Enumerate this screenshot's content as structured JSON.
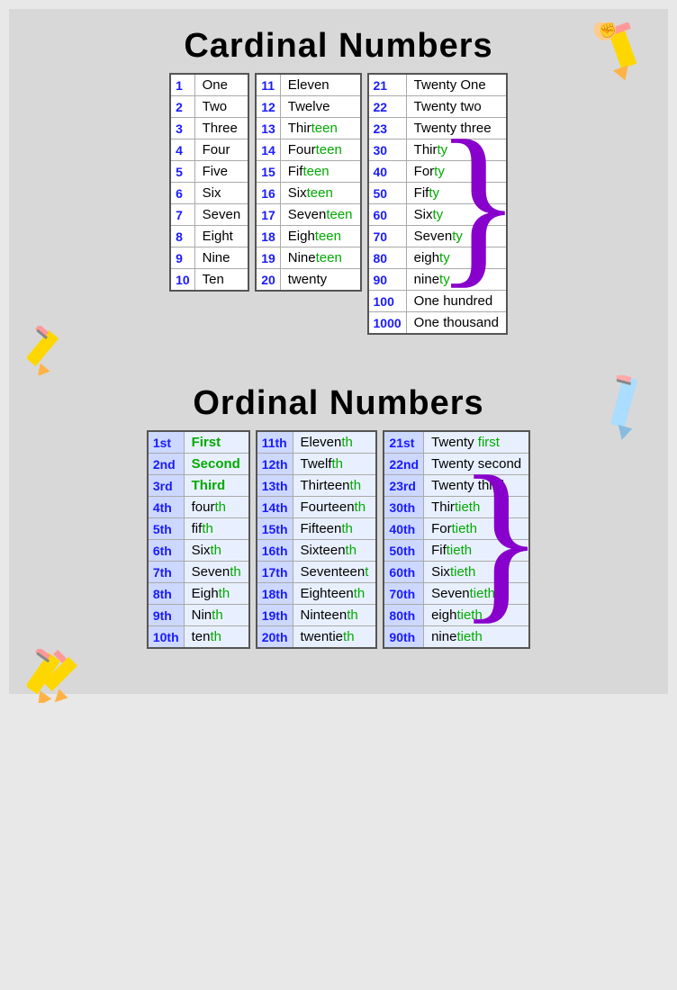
{
  "cardinal": {
    "title": "Cardinal Numbers",
    "table1": [
      {
        "num": "1",
        "word": "One"
      },
      {
        "num": "2",
        "word": "Two"
      },
      {
        "num": "3",
        "word": "Three"
      },
      {
        "num": "4",
        "word": "Four"
      },
      {
        "num": "5",
        "word": "Five"
      },
      {
        "num": "6",
        "word": "Six"
      },
      {
        "num": "7",
        "word": "Seven"
      },
      {
        "num": "8",
        "word": "Eight"
      },
      {
        "num": "9",
        "word": "Nine"
      },
      {
        "num": "10",
        "word": "Ten"
      }
    ],
    "table2": [
      {
        "num": "11",
        "word": "Eleven",
        "green_part": ""
      },
      {
        "num": "12",
        "word": "Twelve",
        "green_part": ""
      },
      {
        "num": "13",
        "word": "Thir",
        "green_part": "teen"
      },
      {
        "num": "14",
        "word": "Four",
        "green_part": "teen"
      },
      {
        "num": "15",
        "word": "Fif",
        "green_part": "teen"
      },
      {
        "num": "16",
        "word": "Six",
        "green_part": "teen"
      },
      {
        "num": "17",
        "word": "Seven",
        "green_part": "teen"
      },
      {
        "num": "18",
        "word": "Eigh",
        "green_part": "teen"
      },
      {
        "num": "19",
        "word": "Nine",
        "green_part": "teen"
      },
      {
        "num": "20",
        "word": "twenty",
        "green_part": ""
      }
    ],
    "table3": [
      {
        "num": "21",
        "word": "Twenty One",
        "green_part": ""
      },
      {
        "num": "22",
        "word": "Twenty two",
        "green_part": ""
      },
      {
        "num": "23",
        "word": "Twenty three",
        "green_part": ""
      },
      {
        "num": "30",
        "word": "Thir",
        "green_part": "ty"
      },
      {
        "num": "40",
        "word": "For",
        "green_part": "ty"
      },
      {
        "num": "50",
        "word": "Fif",
        "green_part": "ty"
      },
      {
        "num": "60",
        "word": "Six",
        "green_part": "ty"
      },
      {
        "num": "70",
        "word": "Seven",
        "green_part": "ty"
      },
      {
        "num": "80",
        "word": "eigh",
        "green_part": "ty"
      },
      {
        "num": "90",
        "word": "nine",
        "green_part": "ty"
      },
      {
        "num": "100",
        "word": "One hundred",
        "green_part": ""
      },
      {
        "num": "1000",
        "word": "One thousand",
        "green_part": ""
      }
    ]
  },
  "ordinal": {
    "title": "Ordinal Numbers",
    "table1": [
      {
        "num": "1st",
        "word": "First",
        "style": "green"
      },
      {
        "num": "2nd",
        "word": "Second",
        "style": "green"
      },
      {
        "num": "3rd",
        "word": "Third",
        "style": "green"
      },
      {
        "num": "4th",
        "word1": "four",
        "word2": "th",
        "style": "mixed"
      },
      {
        "num": "5th",
        "word1": "fif",
        "word2": "th",
        "style": "mixed"
      },
      {
        "num": "6th",
        "word1": "Six",
        "word2": "th",
        "style": "mixed"
      },
      {
        "num": "7th",
        "word1": "Seven",
        "word2": "th",
        "style": "mixed"
      },
      {
        "num": "8th",
        "word1": "Eigh",
        "word2": "th",
        "style": "mixed"
      },
      {
        "num": "9th",
        "word1": "Nin",
        "word2": "th",
        "style": "mixed"
      },
      {
        "num": "10th",
        "word1": "ten",
        "word2": "th",
        "style": "mixed"
      }
    ],
    "table2": [
      {
        "num": "11th",
        "word1": "Eleven",
        "word2": "th"
      },
      {
        "num": "12th",
        "word1": "Twelf",
        "word2": "th"
      },
      {
        "num": "13th",
        "word1": "Thirteen",
        "word2": "th"
      },
      {
        "num": "14th",
        "word1": "Fourteen",
        "word2": "th"
      },
      {
        "num": "15th",
        "word1": "Fifteen",
        "word2": "th"
      },
      {
        "num": "16th",
        "word1": "Sixteen",
        "word2": "th"
      },
      {
        "num": "17th",
        "word1": "Seventeen",
        "word2": "t"
      },
      {
        "num": "18th",
        "word1": "Eighteen",
        "word2": "th"
      },
      {
        "num": "19th",
        "word1": "Ninteen",
        "word2": "th"
      },
      {
        "num": "20th",
        "word1": "twentie",
        "word2": "th"
      }
    ],
    "table3": [
      {
        "num": "21st",
        "word1": "Twenty ",
        "word2": "first"
      },
      {
        "num": "22nd",
        "word1": "Twenty second",
        "word2": ""
      },
      {
        "num": "23rd",
        "word1": "Twenty third",
        "word2": ""
      },
      {
        "num": "30th",
        "word1": "Thir",
        "word2": "tieth"
      },
      {
        "num": "40th",
        "word1": "For",
        "word2": "tieth"
      },
      {
        "num": "50th",
        "word1": "Fif",
        "word2": "tieth"
      },
      {
        "num": "60th",
        "word1": "Six",
        "word2": "tieth"
      },
      {
        "num": "70th",
        "word1": "Seven",
        "word2": "tieth"
      },
      {
        "num": "80th",
        "word1": "eigh",
        "word2": "tieth"
      },
      {
        "num": "90th",
        "word1": "nine",
        "word2": "tieth"
      }
    ]
  }
}
